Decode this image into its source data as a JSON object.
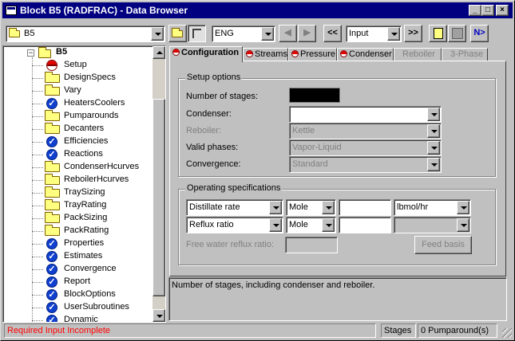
{
  "window": {
    "title": "Block B5 (RADFRAC) - Data Browser"
  },
  "title_buttons": {
    "minimize": "_",
    "maximize": "□",
    "close": "×"
  },
  "toolbar": {
    "block_select": "B5",
    "units": "ENG",
    "back": "◀",
    "forward": "▶",
    "prev": "<<",
    "form_select": "Input",
    "next": ">>",
    "next_input": "N>"
  },
  "tree": {
    "root": "B5",
    "items": [
      {
        "label": "Setup",
        "icon": "required-icon"
      },
      {
        "label": "DesignSpecs",
        "icon": "folder-icon"
      },
      {
        "label": "Vary",
        "icon": "folder-icon"
      },
      {
        "label": "HeatersCoolers",
        "icon": "check-icon"
      },
      {
        "label": "Pumparounds",
        "icon": "folder-icon"
      },
      {
        "label": "Decanters",
        "icon": "folder-icon"
      },
      {
        "label": "Efficiencies",
        "icon": "check-icon"
      },
      {
        "label": "Reactions",
        "icon": "check-icon"
      },
      {
        "label": "CondenserHcurves",
        "icon": "folder-icon"
      },
      {
        "label": "ReboilerHcurves",
        "icon": "folder-icon"
      },
      {
        "label": "TraySizing",
        "icon": "folder-icon"
      },
      {
        "label": "TrayRating",
        "icon": "folder-icon"
      },
      {
        "label": "PackSizing",
        "icon": "folder-icon"
      },
      {
        "label": "PackRating",
        "icon": "folder-icon"
      },
      {
        "label": "Properties",
        "icon": "check-icon"
      },
      {
        "label": "Estimates",
        "icon": "check-icon"
      },
      {
        "label": "Convergence",
        "icon": "check-icon"
      },
      {
        "label": "Report",
        "icon": "check-icon"
      },
      {
        "label": "BlockOptions",
        "icon": "check-icon"
      },
      {
        "label": "UserSubroutines",
        "icon": "check-icon"
      },
      {
        "label": "Dynamic",
        "icon": "check-icon"
      }
    ]
  },
  "tabs": {
    "configuration": "Configuration",
    "streams": "Streams",
    "pressure": "Pressure",
    "condenser": "Condenser",
    "reboiler": "Reboiler",
    "three_phase": "3-Phase"
  },
  "setup_options": {
    "title": "Setup options",
    "stages_label": "Number of stages:",
    "condenser_label": "Condenser:",
    "condenser_value": "",
    "reboiler_label": "Reboiler:",
    "reboiler_value": "Kettle",
    "valid_phases_label": "Valid phases:",
    "valid_phases_value": "Vapor-Liquid",
    "convergence_label": "Convergence:",
    "convergence_value": "Standard"
  },
  "operating_specs": {
    "title": "Operating specifications",
    "row1": {
      "spec": "Distillate rate",
      "basis": "Mole",
      "value": "",
      "units": "lbmol/hr"
    },
    "row2": {
      "spec": "Reflux ratio",
      "basis": "Mole",
      "value": "",
      "units": ""
    },
    "free_water_label": "Free water reflux ratio:",
    "free_water_value": "",
    "feed_basis_button": "Feed basis"
  },
  "description": "Number of stages, including condenser and reboiler.",
  "status": {
    "message": "Required Input Incomplete",
    "stages": "Stages",
    "pumparounds": "0 Pumparound(s)"
  },
  "colors": {
    "title_bar": "#000080",
    "status_error": "#ff0000",
    "face": "#c0c0c0"
  }
}
